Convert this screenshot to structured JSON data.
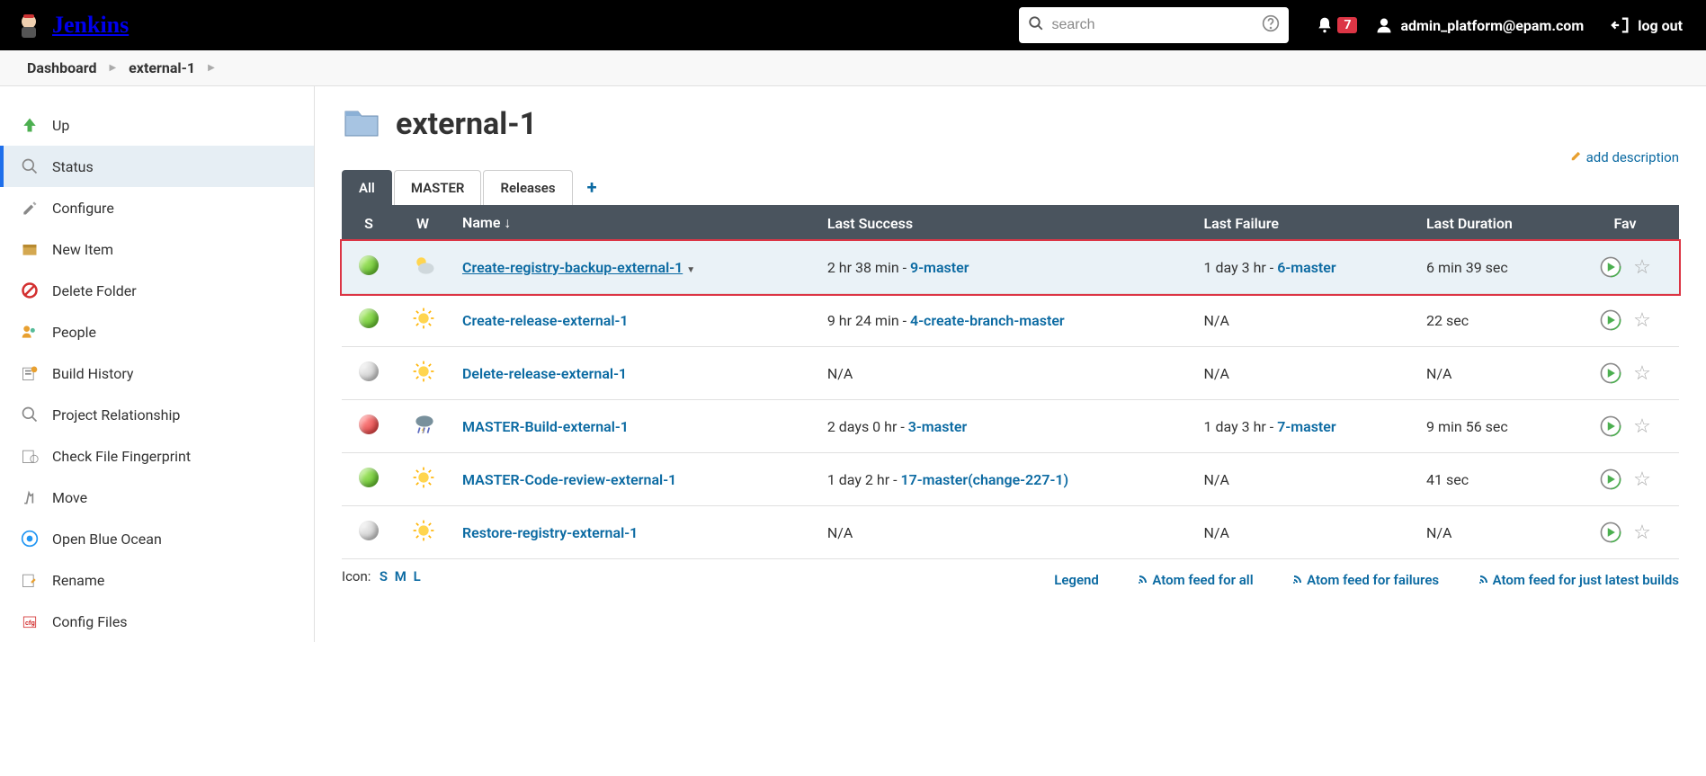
{
  "header": {
    "logo_text": "Jenkins",
    "search_placeholder": "search",
    "notif_count": "7",
    "user": "admin_platform@epam.com",
    "logout": "log out"
  },
  "breadcrumbs": [
    "Dashboard",
    "external-1"
  ],
  "sidebar": {
    "items": [
      {
        "label": "Up",
        "icon": "up"
      },
      {
        "label": "Status",
        "icon": "status",
        "active": true
      },
      {
        "label": "Configure",
        "icon": "configure"
      },
      {
        "label": "New Item",
        "icon": "new-item"
      },
      {
        "label": "Delete Folder",
        "icon": "delete"
      },
      {
        "label": "People",
        "icon": "people"
      },
      {
        "label": "Build History",
        "icon": "history"
      },
      {
        "label": "Project Relationship",
        "icon": "relationship"
      },
      {
        "label": "Check File Fingerprint",
        "icon": "fingerprint"
      },
      {
        "label": "Move",
        "icon": "move"
      },
      {
        "label": "Open Blue Ocean",
        "icon": "blue-ocean"
      },
      {
        "label": "Rename",
        "icon": "rename"
      },
      {
        "label": "Config Files",
        "icon": "config-files"
      }
    ]
  },
  "main": {
    "title": "external-1",
    "add_description": "add description",
    "tabs": [
      "All",
      "MASTER",
      "Releases"
    ],
    "active_tab": 0,
    "columns": {
      "s": "S",
      "w": "W",
      "name": "Name  ↓",
      "last_success": "Last Success",
      "last_failure": "Last Failure",
      "last_duration": "Last Duration",
      "fav": "Fav"
    },
    "jobs": [
      {
        "status": "green",
        "weather": "partly",
        "name": "Create-registry-backup-external-1",
        "highlight": true,
        "dropdown": true,
        "last_success_prefix": "2 hr 38 min - ",
        "last_success_link": "9-master",
        "last_failure_prefix": "1 day 3 hr - ",
        "last_failure_link": "6-master",
        "last_duration": "6 min 39 sec"
      },
      {
        "status": "green",
        "weather": "sunny",
        "name": "Create-release-external-1",
        "last_success_prefix": "9 hr 24 min - ",
        "last_success_link": "4-create-branch-master",
        "last_failure_prefix": "N/A",
        "last_failure_link": "",
        "last_duration": "22 sec"
      },
      {
        "status": "grey",
        "weather": "sunny",
        "name": "Delete-release-external-1",
        "last_success_prefix": "N/A",
        "last_success_link": "",
        "last_failure_prefix": "N/A",
        "last_failure_link": "",
        "last_duration": "N/A"
      },
      {
        "status": "red",
        "weather": "storm",
        "name": "MASTER-Build-external-1",
        "last_success_prefix": "2 days 0 hr - ",
        "last_success_link": "3-master",
        "last_failure_prefix": "1 day 3 hr - ",
        "last_failure_link": "7-master",
        "last_duration": "9 min 56 sec"
      },
      {
        "status": "green",
        "weather": "sunny",
        "name": "MASTER-Code-review-external-1",
        "last_success_prefix": "1 day 2 hr - ",
        "last_success_link": "17-master(change-227-1)",
        "last_failure_prefix": "N/A",
        "last_failure_link": "",
        "last_duration": "41 sec"
      },
      {
        "status": "grey",
        "weather": "sunny",
        "name": "Restore-registry-external-1",
        "last_success_prefix": "N/A",
        "last_success_link": "",
        "last_failure_prefix": "N/A",
        "last_failure_link": "",
        "last_duration": "N/A"
      }
    ],
    "icon_label": "Icon:",
    "icon_sizes": [
      "S",
      "M",
      "L"
    ],
    "feed_links": {
      "legend": "Legend",
      "all": "Atom feed for all",
      "failures": "Atom feed for failures",
      "latest": "Atom feed for just latest builds"
    }
  }
}
